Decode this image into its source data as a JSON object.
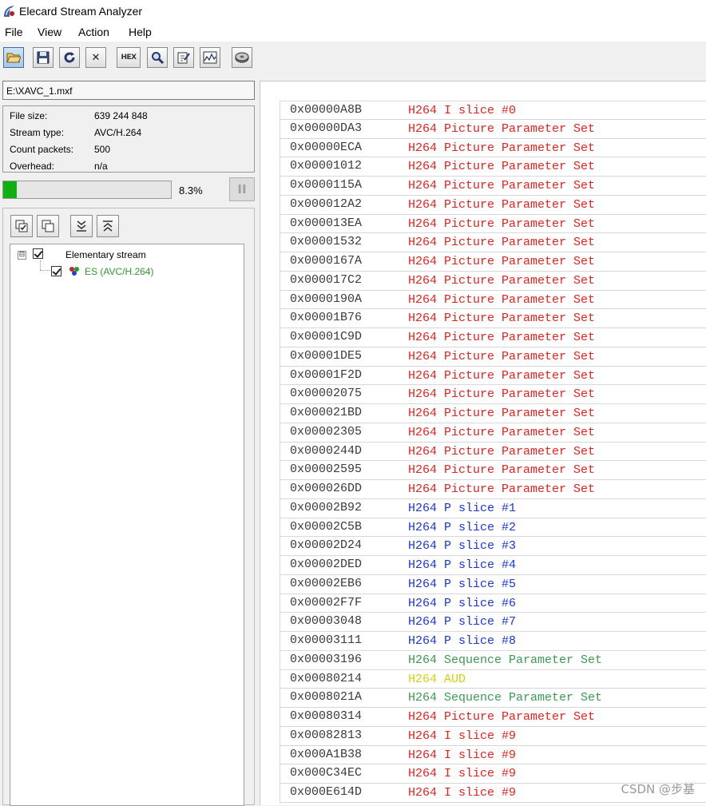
{
  "window": {
    "title": "Elecard Stream Analyzer"
  },
  "menu": [
    "File",
    "View",
    "Action",
    "Help"
  ],
  "toolbar": {
    "hex_label": "HEX",
    "buttons": [
      "open-icon",
      "save-icon",
      "refresh-icon",
      "close-icon",
      "hex-icon",
      "search-icon",
      "edit-icon",
      "graph-icon",
      "disc-icon"
    ],
    "close_glyph": "✕"
  },
  "file_path": "E:\\XAVC_1.mxf",
  "file_info": [
    {
      "key": "File size:",
      "value": "639 244 848"
    },
    {
      "key": "Stream type:",
      "value": "AVC/H.264"
    },
    {
      "key": "Count packets:",
      "value": "500"
    },
    {
      "key": "Overhead:",
      "value": "n/a"
    }
  ],
  "progress": {
    "fraction": 0.083,
    "label": "8.3%"
  },
  "pause_glyph": "II",
  "tree": {
    "root_label": "Elementary stream",
    "child_label": "ES (AVC/H.264)",
    "child_color": "#2e9a2e",
    "expand_glyph": "⊟"
  },
  "colors": {
    "picture_param": "#e8201c",
    "i_slice": "#e8201c",
    "p_slice": "#1a35e0",
    "sequence_param": "#3a9a52",
    "aud": "#d0d010"
  },
  "packets": [
    {
      "offset": "0x00000A8B",
      "type": "H264 I slice #0",
      "kind": "i_slice"
    },
    {
      "offset": "0x00000DA3",
      "type": "H264 Picture Parameter Set",
      "kind": "picture_param"
    },
    {
      "offset": "0x00000ECA",
      "type": "H264 Picture Parameter Set",
      "kind": "picture_param"
    },
    {
      "offset": "0x00001012",
      "type": "H264 Picture Parameter Set",
      "kind": "picture_param"
    },
    {
      "offset": "0x0000115A",
      "type": "H264 Picture Parameter Set",
      "kind": "picture_param"
    },
    {
      "offset": "0x000012A2",
      "type": "H264 Picture Parameter Set",
      "kind": "picture_param"
    },
    {
      "offset": "0x000013EA",
      "type": "H264 Picture Parameter Set",
      "kind": "picture_param"
    },
    {
      "offset": "0x00001532",
      "type": "H264 Picture Parameter Set",
      "kind": "picture_param"
    },
    {
      "offset": "0x0000167A",
      "type": "H264 Picture Parameter Set",
      "kind": "picture_param"
    },
    {
      "offset": "0x000017C2",
      "type": "H264 Picture Parameter Set",
      "kind": "picture_param"
    },
    {
      "offset": "0x0000190A",
      "type": "H264 Picture Parameter Set",
      "kind": "picture_param"
    },
    {
      "offset": "0x00001B76",
      "type": "H264 Picture Parameter Set",
      "kind": "picture_param"
    },
    {
      "offset": "0x00001C9D",
      "type": "H264 Picture Parameter Set",
      "kind": "picture_param"
    },
    {
      "offset": "0x00001DE5",
      "type": "H264 Picture Parameter Set",
      "kind": "picture_param"
    },
    {
      "offset": "0x00001F2D",
      "type": "H264 Picture Parameter Set",
      "kind": "picture_param"
    },
    {
      "offset": "0x00002075",
      "type": "H264 Picture Parameter Set",
      "kind": "picture_param"
    },
    {
      "offset": "0x000021BD",
      "type": "H264 Picture Parameter Set",
      "kind": "picture_param"
    },
    {
      "offset": "0x00002305",
      "type": "H264 Picture Parameter Set",
      "kind": "picture_param"
    },
    {
      "offset": "0x0000244D",
      "type": "H264 Picture Parameter Set",
      "kind": "picture_param"
    },
    {
      "offset": "0x00002595",
      "type": "H264 Picture Parameter Set",
      "kind": "picture_param"
    },
    {
      "offset": "0x000026DD",
      "type": "H264 Picture Parameter Set",
      "kind": "picture_param"
    },
    {
      "offset": "0x00002B92",
      "type": "H264 P slice #1",
      "kind": "p_slice"
    },
    {
      "offset": "0x00002C5B",
      "type": "H264 P slice #2",
      "kind": "p_slice"
    },
    {
      "offset": "0x00002D24",
      "type": "H264 P slice #3",
      "kind": "p_slice"
    },
    {
      "offset": "0x00002DED",
      "type": "H264 P slice #4",
      "kind": "p_slice"
    },
    {
      "offset": "0x00002EB6",
      "type": "H264 P slice #5",
      "kind": "p_slice"
    },
    {
      "offset": "0x00002F7F",
      "type": "H264 P slice #6",
      "kind": "p_slice"
    },
    {
      "offset": "0x00003048",
      "type": "H264 P slice #7",
      "kind": "p_slice"
    },
    {
      "offset": "0x00003111",
      "type": "H264 P slice #8",
      "kind": "p_slice"
    },
    {
      "offset": "0x00003196",
      "type": "H264 Sequence Parameter Set",
      "kind": "sequence_param"
    },
    {
      "offset": "0x00080214",
      "type": "H264 AUD",
      "kind": "aud"
    },
    {
      "offset": "0x0008021A",
      "type": "H264 Sequence Parameter Set",
      "kind": "sequence_param"
    },
    {
      "offset": "0x00080314",
      "type": "H264 Picture Parameter Set",
      "kind": "picture_param"
    },
    {
      "offset": "0x00082813",
      "type": "H264 I slice #9",
      "kind": "i_slice"
    },
    {
      "offset": "0x000A1B38",
      "type": "H264 I slice #9",
      "kind": "i_slice"
    },
    {
      "offset": "0x000C34EC",
      "type": "H264 I slice #9",
      "kind": "i_slice"
    },
    {
      "offset": "0x000E614D",
      "type": "H264 I slice #9",
      "kind": "i_slice"
    }
  ],
  "watermark": "CSDN @步基"
}
